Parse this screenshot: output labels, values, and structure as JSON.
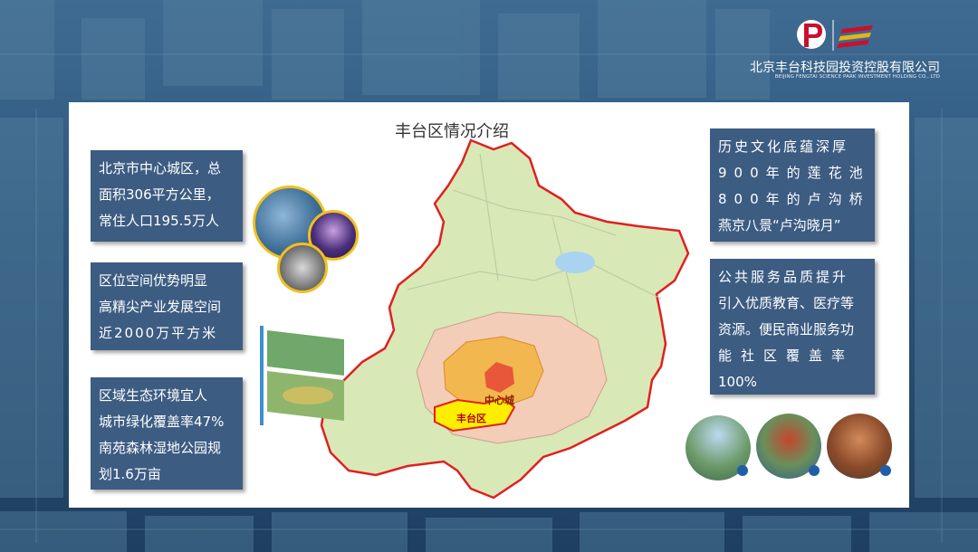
{
  "company": {
    "name_cn": "北京丰台科技园投资控股有限公司",
    "name_en": "BEIJING FENGTAI SCIENCE PARK INVESTMENT HOLDING CO., LTD"
  },
  "title": "丰台区情况介绍",
  "left_boxes": [
    {
      "lines": [
        "北京市中心城区，总",
        "面积306平方公里，",
        "常住人口195.5万人"
      ]
    },
    {
      "lines": [
        "区位空间优势明显",
        "高精尖产业发展空间",
        "近2000万平方米"
      ]
    },
    {
      "lines": [
        "区域生态环境宜人",
        "城市绿化覆盖率47%",
        "南苑森林湿地公园规",
        "划1.6万亩"
      ]
    }
  ],
  "right_boxes": [
    {
      "lines": [
        "历史文化底蕴深厚",
        "900年的莲花池",
        "800年的卢沟桥",
        "燕京八景“卢沟晓月”"
      ]
    },
    {
      "lines": [
        "公共服务品质提升",
        "引入优质教育、医疗等",
        "资源。便民商业服务功",
        "能社区覆盖率",
        "100%"
      ]
    }
  ],
  "map_labels": {
    "center": "中心城",
    "district": "丰台区"
  },
  "colors": {
    "box_bg": "#3c5c82",
    "brand_red": "#c8102e",
    "fengtai_yellow": "#ffee00",
    "boundary_red": "#e02020"
  }
}
